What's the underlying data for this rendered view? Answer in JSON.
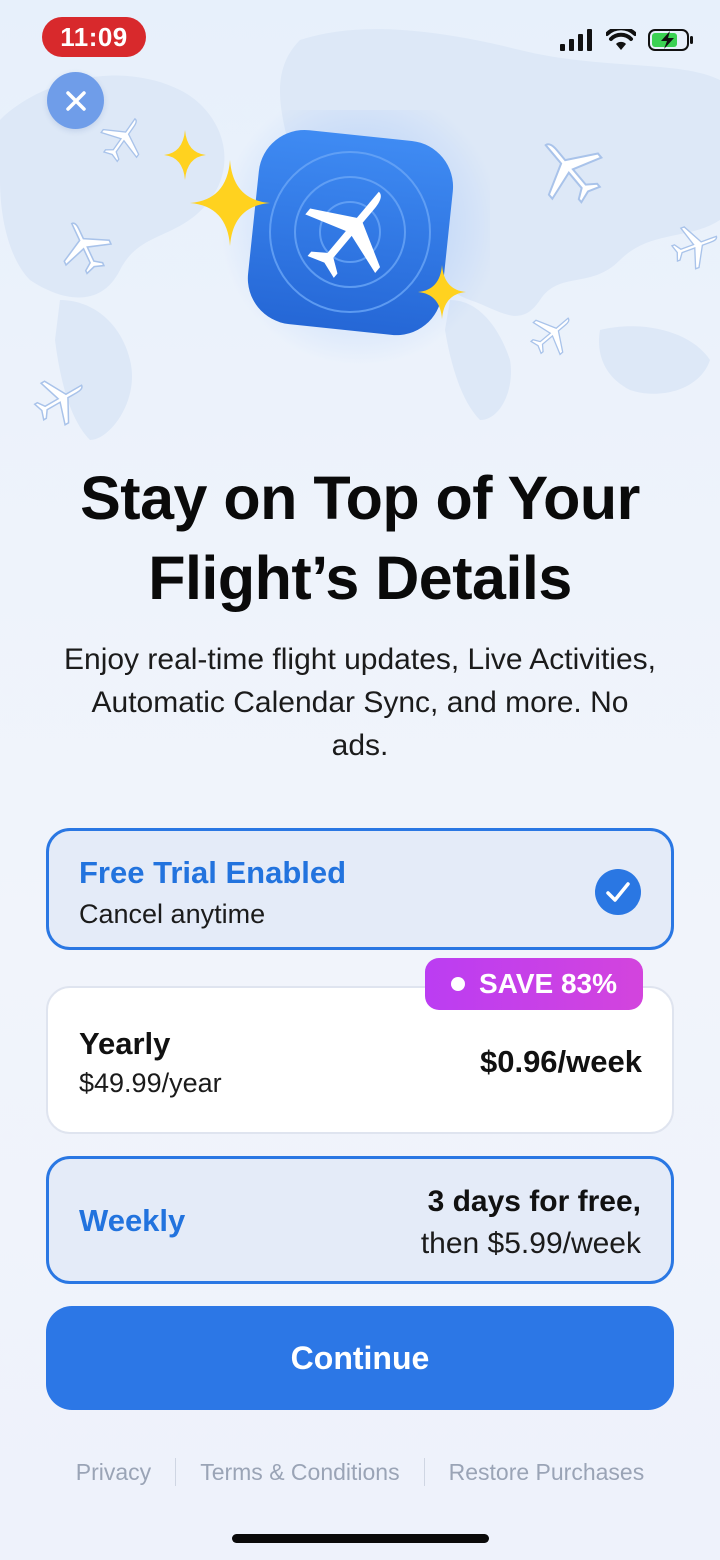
{
  "status_bar": {
    "time": "11:09"
  },
  "hero": {
    "icon": "airplane-radar-app-icon"
  },
  "headline": "Stay on Top of Your Flight’s Details",
  "subtitle": "Enjoy real-time flight updates, Live Activities, Automatic Calendar Sync, and more. No ads.",
  "trial_option": {
    "title": "Free Trial Enabled",
    "subtitle": "Cancel anytime"
  },
  "save_badge": {
    "label": "SAVE 83%"
  },
  "yearly_plan": {
    "title": "Yearly",
    "price": "$49.99/year",
    "per_week": "$0.96/week"
  },
  "weekly_plan": {
    "title": "Weekly",
    "line1": "3 days for free,",
    "line2": "then $5.99/week"
  },
  "continue_label": "Continue",
  "footer": {
    "privacy": "Privacy",
    "terms": "Terms & Conditions",
    "restore": "Restore Purchases"
  },
  "colors": {
    "accent": "#2a77e3",
    "badge": "#c840e8",
    "time_pill": "#d8292c"
  }
}
